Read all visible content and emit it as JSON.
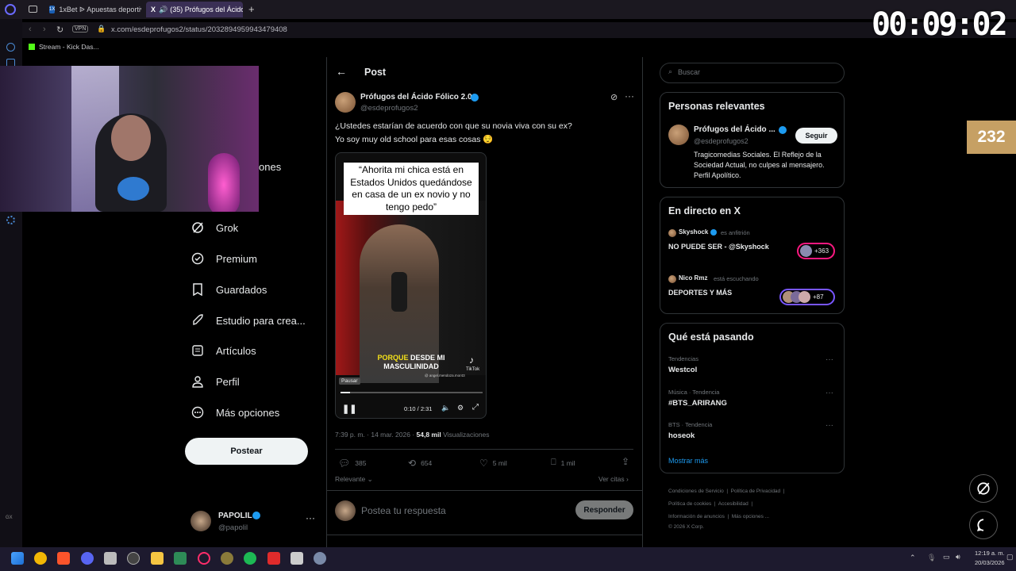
{
  "browser": {
    "tabs": [
      {
        "label": "1xBet ᐉ Apuestas deportiv"
      },
      {
        "label": "(35) Prófugos del Ácido"
      }
    ],
    "url": "x.com/esdeprofugos2/status/2032894959943479408",
    "bookmark": "Stream - Kick Das..."
  },
  "overlay": {
    "timer": "00:09:02",
    "viewer_badge": "232"
  },
  "nav": {
    "partial_item": "ones",
    "items": [
      {
        "label": "Grok",
        "icon": "grok-icon"
      },
      {
        "label": "Premium",
        "icon": "premium-icon"
      },
      {
        "label": "Guardados",
        "icon": "bookmark-icon"
      },
      {
        "label": "Estudio para crea...",
        "icon": "rocket-icon"
      },
      {
        "label": "Artículos",
        "icon": "article-icon"
      },
      {
        "label": "Perfil",
        "icon": "profile-icon"
      },
      {
        "label": "Más opciones",
        "icon": "more-icon"
      }
    ],
    "post_button": "Postear",
    "account": {
      "name": "PAPOLIL",
      "handle": "@papolil"
    }
  },
  "post": {
    "header": "Post",
    "author": "Prófugos del Ácido Fólico 2.0",
    "handle": "@esdeprofugos2",
    "text_line1": "¿Ustedes estarían de acuerdo con que su novia viva con su ex?",
    "text_line2": "Yo soy muy old school para esas cosas 😌",
    "video_caption": "“Ahorita mi chica está en Estados Unidos quedándose en casa de un ex novio y no tengo pedo”",
    "subtitle_highlight": "PORQUE",
    "subtitle_rest1": "DESDE MI",
    "subtitle_rest2": "MASCULINIDAD",
    "tiktok_label": "TikTok",
    "tiktok_user": "@ angel.mendoza.mor43",
    "pause_tooltip": "Pausar",
    "time": "0:10 / 2:31",
    "progress": 0.066,
    "timestamp": "7:39 p. m. · 14 mar. 2026 · ",
    "views_count": "54,8 mil",
    "views_label": "Visualizaciones",
    "replies": "385",
    "reposts": "654",
    "likes": "5 mil",
    "bookmarks": "1 mil",
    "sort": "Relevante",
    "quotes_link": "Ver citas",
    "reply_placeholder": "Postea tu respuesta",
    "reply_button": "Responder"
  },
  "right": {
    "search_placeholder": "Buscar",
    "relevant": {
      "title": "Personas relevantes",
      "name": "Prófugos del Ácido ...",
      "handle": "@esdeprofugos2",
      "follow": "Seguir",
      "bio": "Tragicomedias Sociales. El Reflejo de la Sociedad Actual, no culpes al mensajero. Perfil Apolítico."
    },
    "live": {
      "title": "En directo en X",
      "spaces": [
        {
          "host": "Skyshock",
          "role": "es anfitrión",
          "title": "NO PUEDE SER - @Skyshock",
          "count": "+363"
        },
        {
          "host": "Nico Rmz",
          "role": "está escuchando",
          "title": "DEPORTES Y MÁS",
          "count": "+87"
        }
      ]
    },
    "trends": {
      "title": "Qué está pasando",
      "items": [
        {
          "context": "Tendencias",
          "name": "Westcol"
        },
        {
          "context": "Música · Tendencia",
          "name": "#BTS_ARIRANG"
        },
        {
          "context": "BTS · Tendencia",
          "name": "hoseok"
        }
      ],
      "more": "Mostrar más"
    },
    "footer": {
      "line1": [
        "Condiciones de Servicio",
        "Política de Privacidad"
      ],
      "line2": [
        "Política de cookies",
        "Accesibilidad"
      ],
      "line3": [
        "Información de anuncios",
        "Más opciones ..."
      ],
      "copyright": "© 2026 X Corp."
    }
  },
  "taskbar": {
    "time": "12:19 a. m.",
    "date": "20/03/2026"
  },
  "colors": {
    "accent": "#1d9bf0",
    "background": "#000000",
    "border": "#2f3336",
    "muted": "#71767b",
    "live_pink": "#f91880",
    "live_purple": "#7856ff"
  }
}
